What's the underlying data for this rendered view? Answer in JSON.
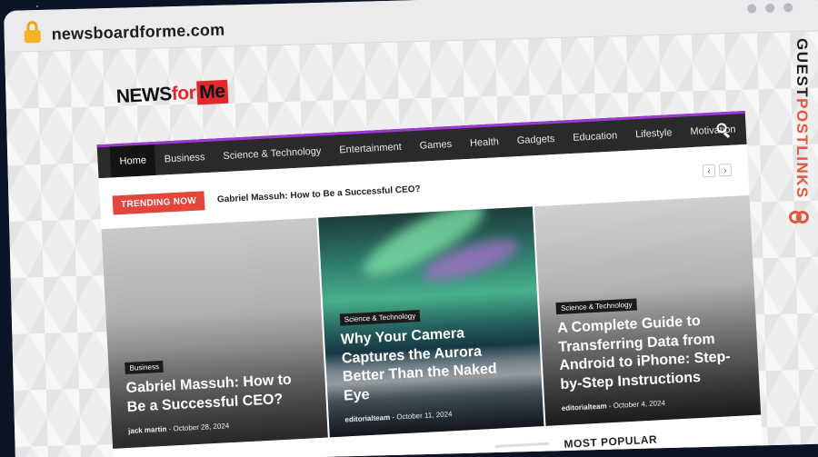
{
  "browser": {
    "url": "newsboardforme.com"
  },
  "site": {
    "logo": {
      "part1": "NEWS",
      "part2": "for",
      "part3": "Me"
    },
    "nav": [
      {
        "label": "Home"
      },
      {
        "label": "Business"
      },
      {
        "label": "Science & Technology"
      },
      {
        "label": "Entertainment"
      },
      {
        "label": "Games"
      },
      {
        "label": "Health"
      },
      {
        "label": "Gadgets"
      },
      {
        "label": "Education"
      },
      {
        "label": "Lifestyle"
      },
      {
        "label": "Motivation"
      }
    ],
    "trending": {
      "label": "TRENDING NOW",
      "title": "Gabriel Massuh: How to Be a Successful CEO?",
      "prev": "‹",
      "next": "›"
    },
    "cards": [
      {
        "category": "Business",
        "title": "Gabriel Massuh: How to Be a Successful CEO?",
        "author": "jack martin",
        "date": "October 28, 2024"
      },
      {
        "category": "Science & Technology",
        "title": "Why Your Camera Captures the Aurora Better Than the Naked Eye",
        "author": "editorialteam",
        "date": "October 11, 2024"
      },
      {
        "category": "Science & Technology",
        "title": "A Complete Guide to Transferring Data from Android to iPhone: Step-by-Step Instructions",
        "author": "editorialteam",
        "date": "October 4, 2024"
      }
    ],
    "most_popular": "MOST POPULAR"
  },
  "badge": {
    "text_a": "GUEST",
    "text_b": "POSTLINKS"
  },
  "colors": {
    "accent_red": "#e4262d",
    "nav_border": "#9c3ad0",
    "trending_red": "#e4463c",
    "badge_orange": "#e4563c"
  }
}
